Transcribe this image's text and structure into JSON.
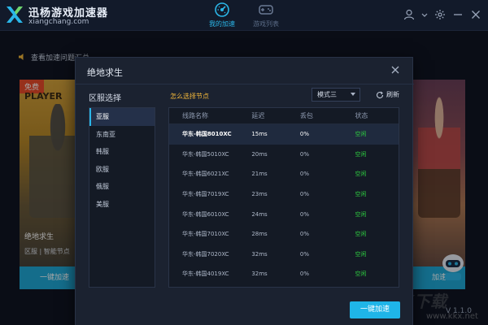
{
  "app": {
    "title": "迅杨游戏加速器",
    "site": "xiangchang.com",
    "version": "V 1.1.0",
    "colors": {
      "accent": "#1fb5e8",
      "status_ok": "#2ecc40",
      "link": "#f0b53a"
    }
  },
  "nav": {
    "tabs": [
      {
        "label": "我的加速",
        "icon": "speed-icon",
        "active": true
      },
      {
        "label": "游戏列表",
        "icon": "gamepad-icon",
        "active": false
      }
    ]
  },
  "header_right": {
    "icons": [
      "user-icon",
      "chevron-down-icon",
      "gear-icon",
      "minimize-icon",
      "close-icon"
    ]
  },
  "notice": {
    "text": "查看加速问题汇总"
  },
  "bg_cards": {
    "left": {
      "badge": "免费",
      "art_text": "PLAYER",
      "title": "绝地求生",
      "sub": "区服 | 智能节点",
      "button": "一键加速"
    },
    "right": {
      "button": "加速"
    }
  },
  "watermark": {
    "a": "KK下载",
    "b": "www.kkx.net"
  },
  "modal": {
    "title": "绝地求生",
    "region_title": "区服选择",
    "how_to": "怎么选择节点",
    "mode": "模式三",
    "refresh": "刷新",
    "regions": [
      "亚服",
      "东南亚",
      "韩服",
      "欧服",
      "俄服",
      "美服"
    ],
    "active_region": 0,
    "table": {
      "headers": [
        "线路名称",
        "延迟",
        "丢包",
        "状态"
      ],
      "rows": [
        {
          "name": "华东-韩国8010XC",
          "ping": "15ms",
          "loss": "0%",
          "status": "空闲"
        },
        {
          "name": "华东-韩国5010XC",
          "ping": "20ms",
          "loss": "0%",
          "status": "空闲"
        },
        {
          "name": "华东-韩国6021XC",
          "ping": "21ms",
          "loss": "0%",
          "status": "空闲"
        },
        {
          "name": "华东-韩国7019XC",
          "ping": "23ms",
          "loss": "0%",
          "status": "空闲"
        },
        {
          "name": "华东-韩国6010XC",
          "ping": "24ms",
          "loss": "0%",
          "status": "空闲"
        },
        {
          "name": "华东-韩国7010XC",
          "ping": "28ms",
          "loss": "0%",
          "status": "空闲"
        },
        {
          "name": "华东-韩国7020XC",
          "ping": "32ms",
          "loss": "0%",
          "status": "空闲"
        },
        {
          "name": "华东-韩国4019XC",
          "ping": "32ms",
          "loss": "0%",
          "status": "空闲"
        }
      ],
      "selected_row": 0
    },
    "accelerate_button": "一键加速"
  }
}
